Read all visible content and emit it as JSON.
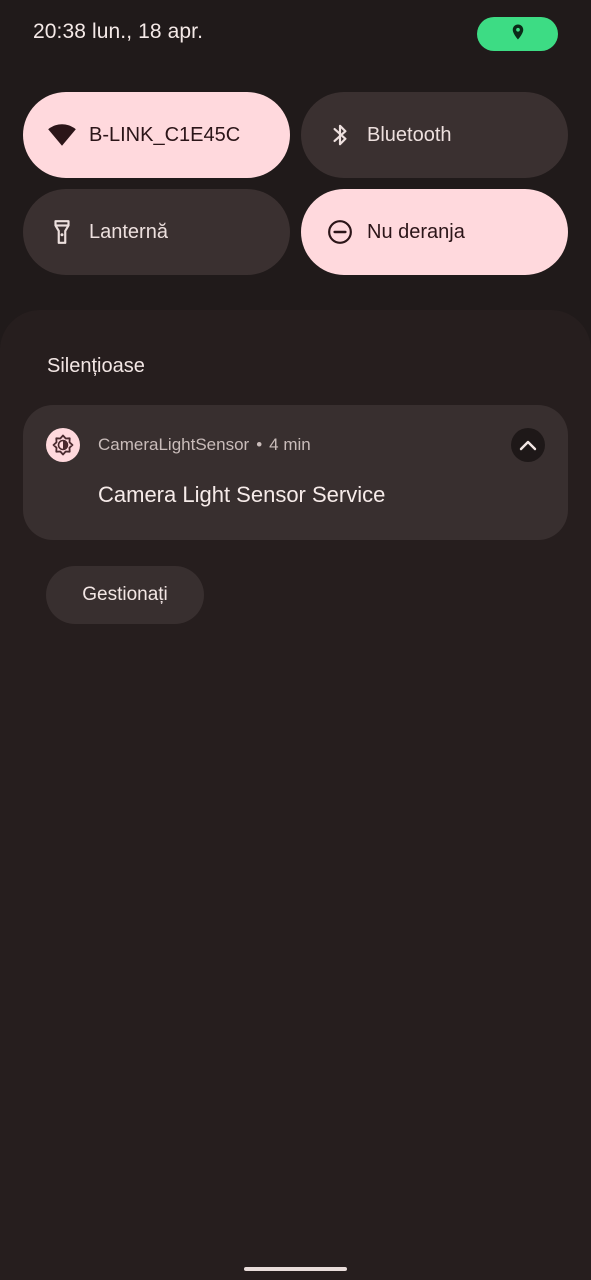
{
  "status_bar": {
    "time_date": "20:38 lun., 18 apr.",
    "location_icon": "location-pin-icon",
    "location_color": "#3ddc84"
  },
  "quick_settings": {
    "tiles": [
      {
        "label": "B-LINK_C1E45C",
        "icon": "wifi-icon",
        "state": "on"
      },
      {
        "label": "Bluetooth",
        "icon": "bluetooth-icon",
        "state": "off"
      },
      {
        "label": "Lanternă",
        "icon": "flashlight-icon",
        "state": "off"
      },
      {
        "label": "Nu deranja",
        "icon": "do-not-disturb-icon",
        "state": "on"
      }
    ]
  },
  "notifications": {
    "section_title": "Silențioase",
    "items": [
      {
        "app_name": "CameraLightSensor",
        "separator": "•",
        "time": "4 min",
        "title": "Camera Light Sensor Service",
        "app_icon": "brightness-icon",
        "expand_icon": "chevron-up-icon"
      }
    ],
    "manage_label": "Gestionați"
  },
  "colors": {
    "background": "#201a1a",
    "tile_active": "#ffd9dd",
    "tile_inactive": "#3a3030",
    "notification_card": "#382f2f"
  }
}
